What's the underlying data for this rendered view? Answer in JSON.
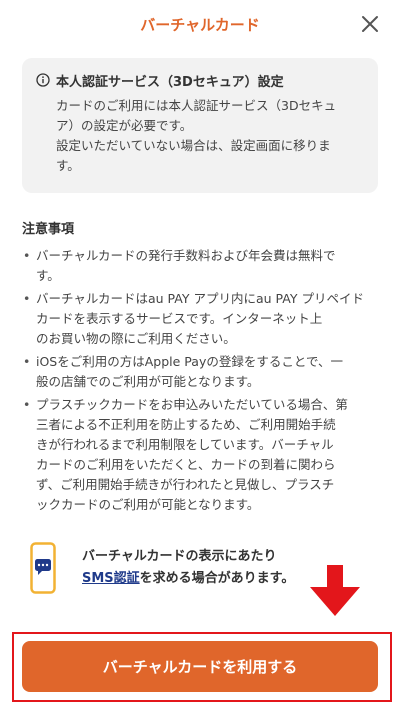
{
  "header": {
    "title": "バーチャルカード",
    "close_icon": "close-icon"
  },
  "info_box": {
    "icon": "info-circle-icon",
    "title": "本人認証サービス（3Dセキュア）設定",
    "lines": [
      "カードのご利用には本人認証サービス（3Dセキュ",
      "ア）の設定が必要です。",
      "設定いただいていない場合は、設定画面に移りま",
      "す。"
    ]
  },
  "notes": {
    "title": "注意事項",
    "items": [
      [
        "バーチャルカードの発行手数料および年会費は無料で",
        "す。"
      ],
      [
        "バーチャルカードはau PAY アプリ内にau PAY プリペイド",
        "カードを表示するサービスです。インターネット上",
        "のお買い物の際にご利用ください。"
      ],
      [
        "iOSをご利用の方はApple Payの登録をすることで、一",
        "般の店舗でのご利用が可能となります。"
      ],
      [
        "プラスチックカードをお申込みいただいている場合、第",
        "三者による不正利用を防止するため、ご利用開始手続",
        "きが行われるまで利用制限をしています。バーチャル",
        "カードのご利用をいただくと、カードの到着に関わら",
        "ず、ご利用開始手続きが行われたと見做し、プラスチ",
        "ックカードのご利用が可能となります。"
      ]
    ]
  },
  "sms": {
    "icon": "phone-message-icon",
    "line1": "バーチャルカードの表示にあたり",
    "highlight": "SMS認証",
    "line2_rest": "を求める場合があります。"
  },
  "arrow_icon": "arrow-down-icon",
  "cta": {
    "label": "バーチャルカードを利用する"
  },
  "colors": {
    "brand": "#e0662b",
    "highlight_frame": "#e3161b",
    "link": "#1f3a8a",
    "info_bg": "#f2f2f2"
  }
}
